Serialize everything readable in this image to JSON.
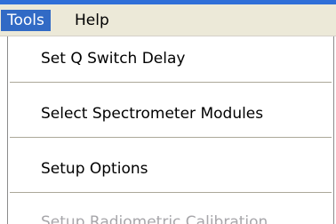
{
  "menubar": {
    "tools_label": "Tools",
    "help_label": "Help"
  },
  "tools_menu": {
    "items": [
      {
        "label": "Set Q Switch Delay",
        "enabled": true
      },
      {
        "label": "Select Spectrometer Modules",
        "enabled": true
      },
      {
        "label": "Setup Options",
        "enabled": true
      },
      {
        "label": "Setup Radiometric Calibration",
        "enabled": false
      }
    ]
  },
  "colors": {
    "menubar_bg": "#ece9d8",
    "highlight_bg": "#316ac5",
    "highlight_text": "#ffffff",
    "disabled_text": "#a7a6aa",
    "separator": "#aca899"
  }
}
